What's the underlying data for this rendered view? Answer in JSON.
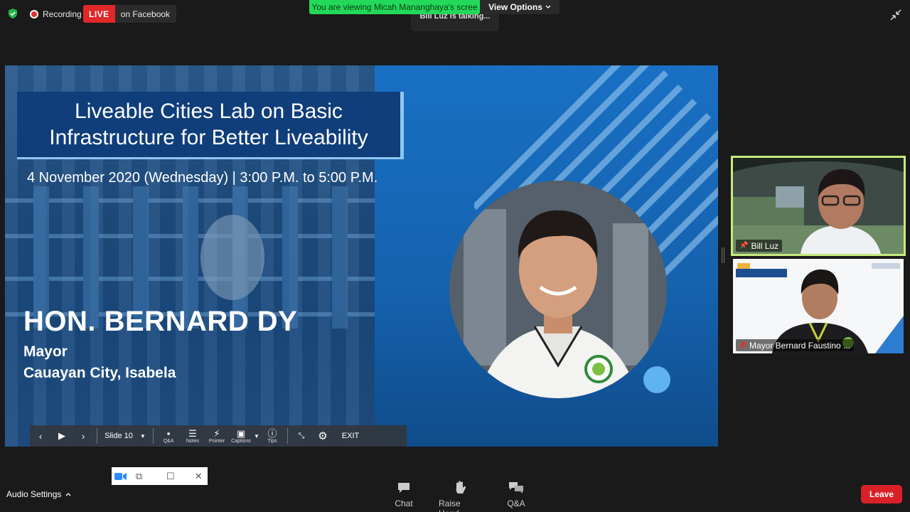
{
  "top_bar": {
    "recording_label": "Recording",
    "live_badge": "LIVE",
    "live_target": "on Facebook",
    "viewing_banner": "You are viewing Micah Mananghaya's scree",
    "view_options_label": "View Options",
    "talking_label": "Bill Luz is talking..."
  },
  "slide": {
    "title_line1": "Liveable Cities Lab on Basic",
    "title_line2": "Infrastructure for Better Liveability",
    "date": "4 November 2020 (Wednesday) | 3:00 P.M. to 5:00 P.M.",
    "speaker_name": "HON. BERNARD DY",
    "speaker_role": "Mayor",
    "speaker_city": "Cauayan City, Isabela",
    "colors": {
      "title_box": "#0f3e7a",
      "accent": "#8fc7f2",
      "dot": "#5fb3ee"
    }
  },
  "slideshow_controls": {
    "current_slide": "Slide 10",
    "qa_label": "Q&A",
    "notes_label": "Notes",
    "pointer_label": "Pointer",
    "captions_label": "Captions",
    "tips_label": "Tips",
    "exit_label": "EXIT"
  },
  "participants": [
    {
      "name": "Bill Luz",
      "icon": "pin-icon"
    },
    {
      "name": "Mayor Bernard Faustino ...",
      "icon": "mic-muted-icon"
    }
  ],
  "bottom_bar": {
    "audio_settings": "Audio Settings",
    "chat": "Chat",
    "raise_hand": "Raise Hand",
    "qa": "Q&A",
    "leave": "Leave"
  }
}
